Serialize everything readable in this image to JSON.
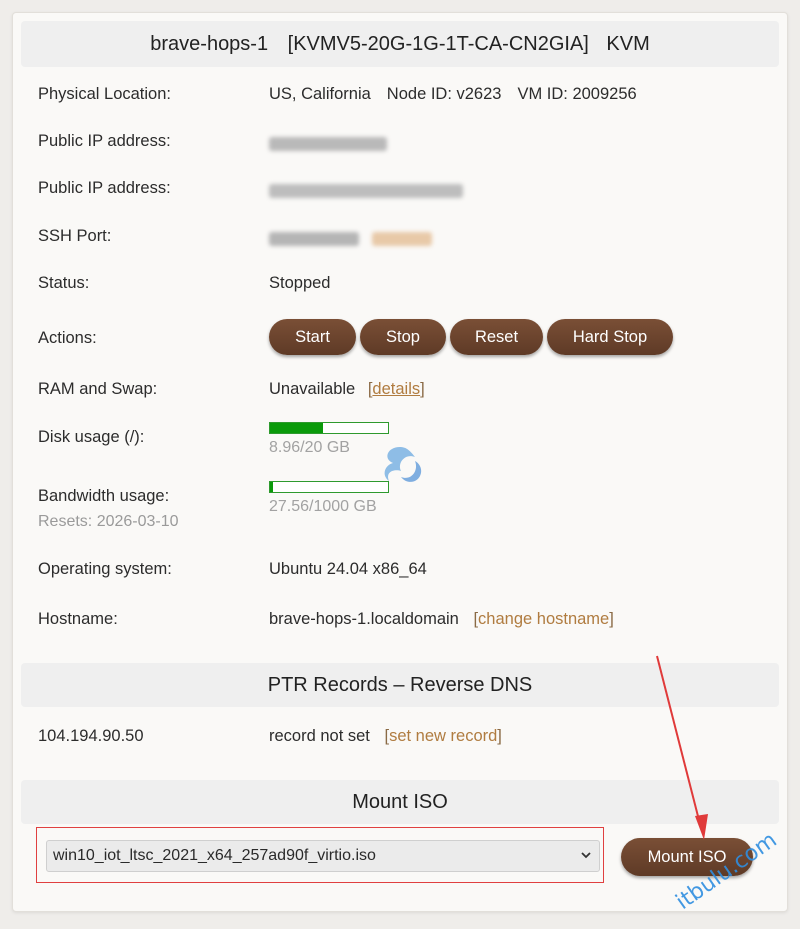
{
  "header": {
    "name": "brave-hops-1",
    "plan": "[KVMV5-20G-1G-1T-CA-CN2GIA]",
    "virt": "KVM"
  },
  "details": {
    "location_label": "Physical Location:",
    "location_value": "US, California",
    "node_id": "Node ID: v2623",
    "vm_id": "VM ID: 2009256",
    "ipv4_label": "Public IP address:",
    "ipv6_label": "Public IP address:",
    "ssh_label": "SSH Port:",
    "status_label": "Status:",
    "status_value": "Stopped",
    "actions_label": "Actions:",
    "ram_label": "RAM and Swap:",
    "ram_value": "Unavailable",
    "ram_details_link": "details",
    "disk_label": "Disk usage (/):",
    "disk_text": "8.96/20 GB",
    "disk_fraction": 0.448,
    "bw_label": "Bandwidth usage:",
    "bw_resets": "Resets: 2026-03-10",
    "bw_text": "27.56/1000 GB",
    "bw_fraction": 0.028,
    "os_label": "Operating system:",
    "os_value": "Ubuntu 24.04 x86_64",
    "hostname_label": "Hostname:",
    "hostname_value": "brave-hops-1.localdomain",
    "change_hostname_link": "change hostname"
  },
  "actions": {
    "start": "Start",
    "stop": "Stop",
    "reset": "Reset",
    "hard_stop": "Hard Stop"
  },
  "ptr": {
    "title": "PTR Records – Reverse DNS",
    "ip": "104.194.90.50",
    "record_status": "record not set",
    "set_link": "set new record"
  },
  "iso": {
    "title": "Mount ISO",
    "selected": "win10_iot_ltsc_2021_x64_257ad90f_virtio.iso",
    "mount_button": "Mount ISO"
  },
  "watermark": "itbulu.com",
  "colors": {
    "button_brown": "#6b4430",
    "link": "#b07c40",
    "progress_green": "#0a9a0a",
    "annotation_red": "#e04040",
    "watermark_blue": "#2f8ee0"
  }
}
